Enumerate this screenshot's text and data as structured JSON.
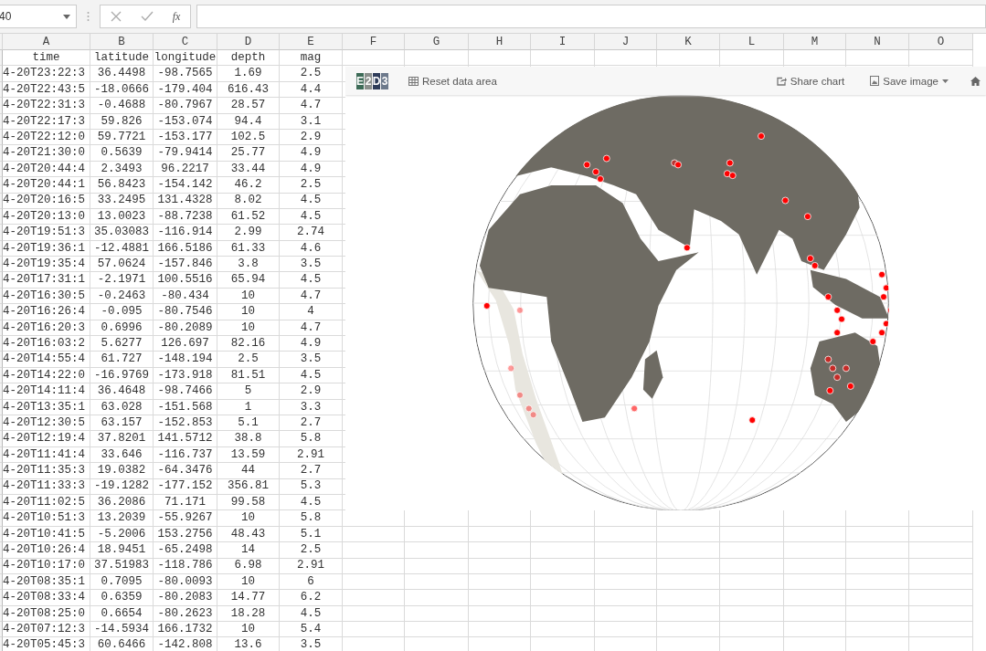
{
  "formula_bar": {
    "name_box": "40",
    "function_label": "fx"
  },
  "sheet": {
    "columns": [
      "A",
      "B",
      "C",
      "D",
      "E",
      "F",
      "G",
      "H",
      "I",
      "J",
      "K",
      "L",
      "M",
      "N",
      "O"
    ],
    "rows": [
      [
        "time",
        "latitude",
        "longitude",
        "depth",
        "mag"
      ],
      [
        "4-20T23:22:3",
        "36.4498",
        "-98.7565",
        "1.69",
        "2.5"
      ],
      [
        "4-20T22:43:5",
        "-18.0666",
        "-179.404",
        "616.43",
        "4.4"
      ],
      [
        "4-20T22:31:3",
        "-0.4688",
        "-80.7967",
        "28.57",
        "4.7"
      ],
      [
        "4-20T22:17:3",
        "59.826",
        "-153.074",
        "94.4",
        "3.1"
      ],
      [
        "4-20T22:12:0",
        "59.7721",
        "-153.177",
        "102.5",
        "2.9"
      ],
      [
        "4-20T21:30:0",
        "0.5639",
        "-79.9414",
        "25.77",
        "4.9"
      ],
      [
        "4-20T20:44:4",
        "2.3493",
        "96.2217",
        "33.44",
        "4.9"
      ],
      [
        "4-20T20:44:1",
        "56.8423",
        "-154.142",
        "46.2",
        "2.5"
      ],
      [
        "4-20T20:16:5",
        "33.2495",
        "131.4328",
        "8.02",
        "4.5"
      ],
      [
        "4-20T20:13:0",
        "13.0023",
        "-88.7238",
        "61.52",
        "4.5"
      ],
      [
        "4-20T19:51:3",
        "35.03083",
        "-116.914",
        "2.99",
        "2.74"
      ],
      [
        "4-20T19:36:1",
        "-12.4881",
        "166.5186",
        "61.33",
        "4.6"
      ],
      [
        "4-20T19:35:4",
        "57.0624",
        "-157.846",
        "3.8",
        "3.5"
      ],
      [
        "4-20T17:31:1",
        "-2.1971",
        "100.5516",
        "65.94",
        "4.5"
      ],
      [
        "4-20T16:30:5",
        "-0.2463",
        "-80.434",
        "10",
        "4.7"
      ],
      [
        "4-20T16:26:4",
        "-0.095",
        "-80.7546",
        "10",
        "4"
      ],
      [
        "4-20T16:20:3",
        "0.6996",
        "-80.2089",
        "10",
        "4.7"
      ],
      [
        "4-20T16:03:2",
        "5.6277",
        "126.697",
        "82.16",
        "4.9"
      ],
      [
        "4-20T14:55:4",
        "61.727",
        "-148.194",
        "2.5",
        "3.5"
      ],
      [
        "4-20T14:22:0",
        "-16.9769",
        "-173.918",
        "81.51",
        "4.5"
      ],
      [
        "4-20T14:11:4",
        "36.4648",
        "-98.7466",
        "5",
        "2.9"
      ],
      [
        "4-20T13:35:1",
        "63.028",
        "-151.568",
        "1",
        "3.3"
      ],
      [
        "4-20T12:30:5",
        "63.157",
        "-152.853",
        "5.1",
        "2.7"
      ],
      [
        "4-20T12:19:4",
        "37.8201",
        "141.5712",
        "38.8",
        "5.8"
      ],
      [
        "4-20T11:41:4",
        "33.646",
        "-116.737",
        "13.59",
        "2.91"
      ],
      [
        "4-20T11:35:3",
        "19.0382",
        "-64.3476",
        "44",
        "2.7"
      ],
      [
        "4-20T11:33:3",
        "-19.1282",
        "-177.152",
        "356.81",
        "5.3"
      ],
      [
        "4-20T11:02:5",
        "36.2086",
        "71.171",
        "99.58",
        "4.5"
      ],
      [
        "4-20T10:51:3",
        "13.2039",
        "-55.9267",
        "10",
        "5.8"
      ],
      [
        "4-20T10:41:5",
        "-5.2006",
        "153.2756",
        "48.43",
        "5.1"
      ],
      [
        "4-20T10:26:4",
        "18.9451",
        "-65.2498",
        "14",
        "2.5"
      ],
      [
        "4-20T10:17:0",
        "37.51983",
        "-118.786",
        "6.98",
        "2.91"
      ],
      [
        "4-20T08:35:1",
        "0.7095",
        "-80.0093",
        "10",
        "6"
      ],
      [
        "4-20T08:33:4",
        "0.6359",
        "-80.2083",
        "14.77",
        "6.2"
      ],
      [
        "4-20T08:25:0",
        "0.6654",
        "-80.2623",
        "18.28",
        "4.5"
      ],
      [
        "4-20T07:12:3",
        "-14.5934",
        "166.1732",
        "10",
        "5.4"
      ],
      [
        "4-20T05:45:3",
        "60.6466",
        "-142.808",
        "13.6",
        "3.5"
      ]
    ]
  },
  "chart": {
    "logo": [
      "E",
      "2",
      "D",
      "3"
    ],
    "reset_button": "Reset data area",
    "share_button": "Share chart",
    "save_button": "Save image"
  }
}
